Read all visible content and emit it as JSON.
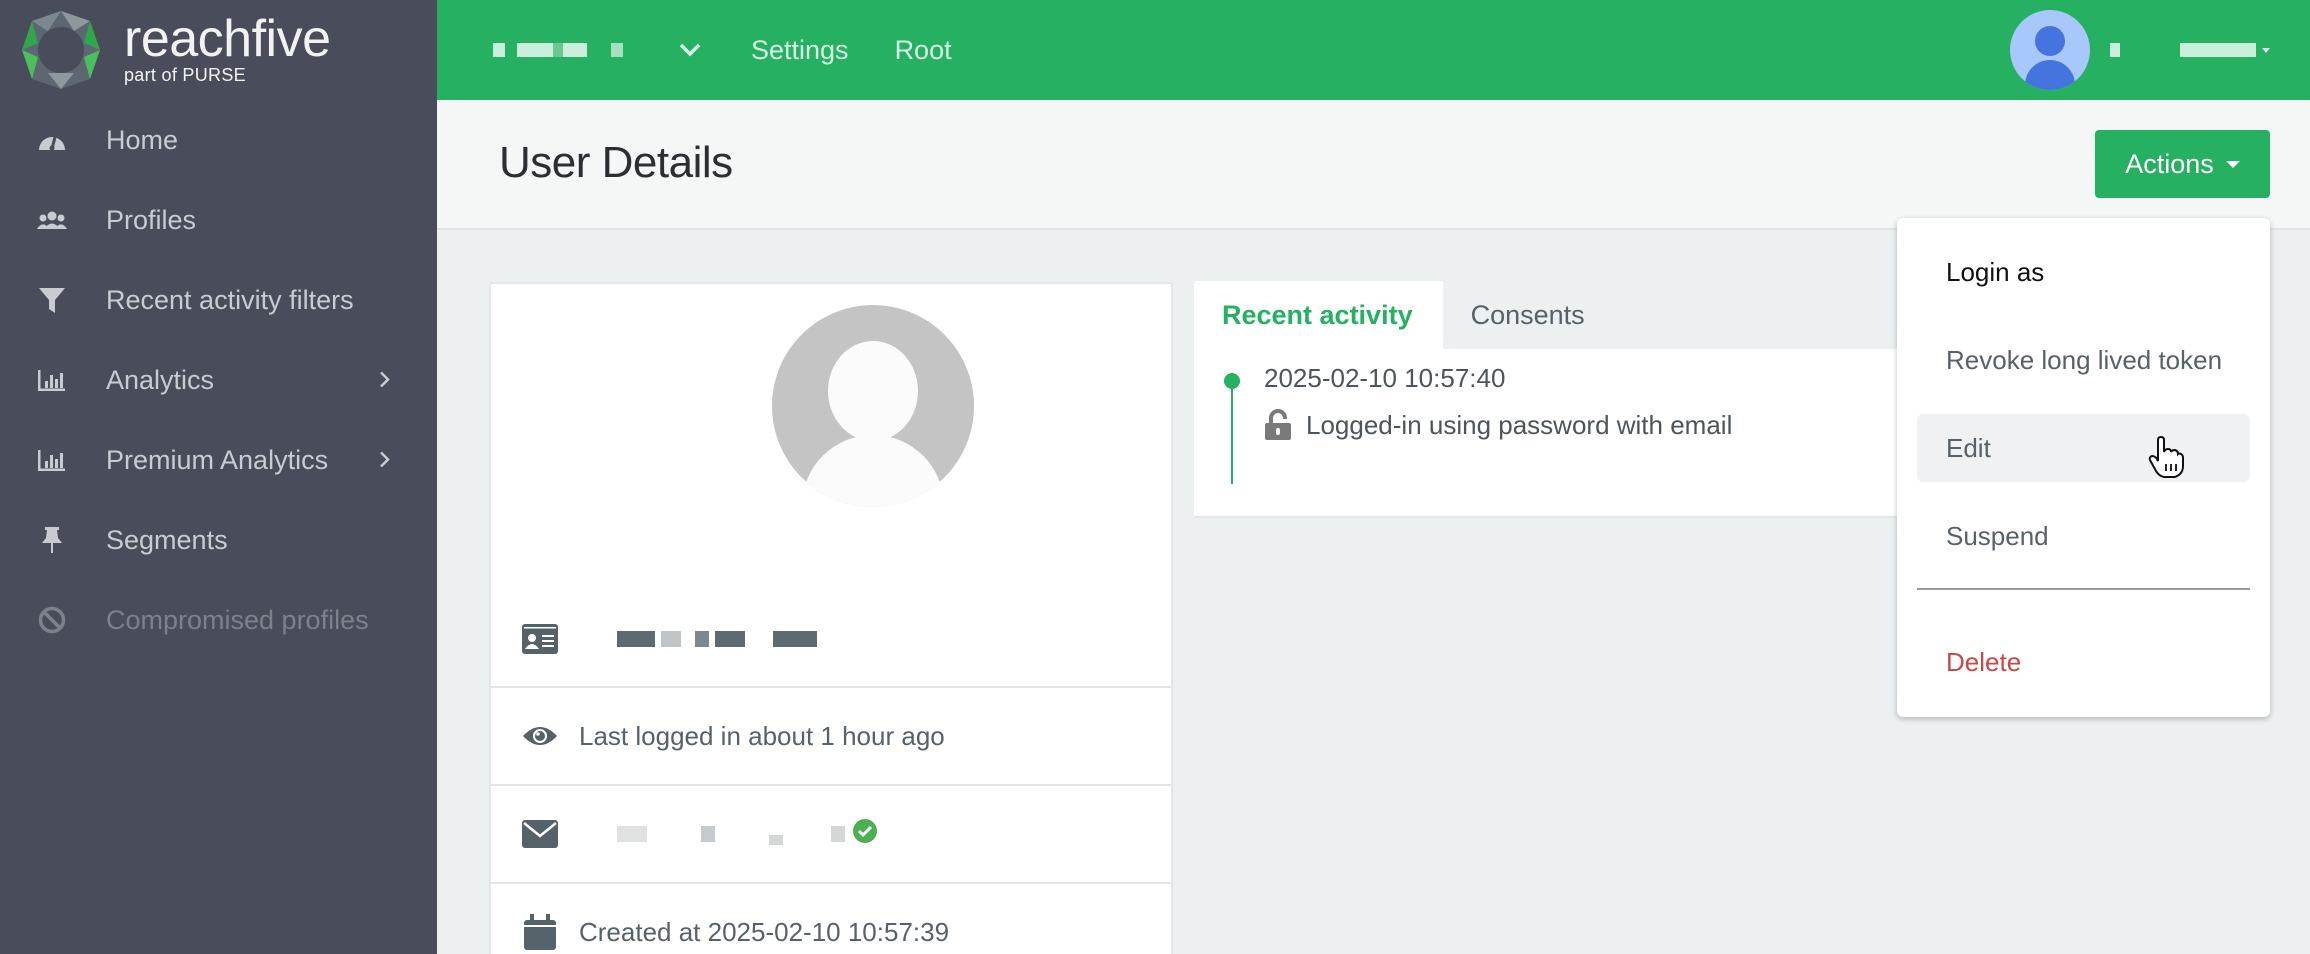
{
  "brand": {
    "name": "reachfive",
    "subtitle": "part of PURSE"
  },
  "sidebar": {
    "items": [
      {
        "label": "Home",
        "icon": "dashboard-gauge-icon",
        "has_submenu": false,
        "disabled": false
      },
      {
        "label": "Profiles",
        "icon": "users-icon",
        "has_submenu": false,
        "disabled": false
      },
      {
        "label": "Recent activity filters",
        "icon": "filter-icon",
        "has_submenu": false,
        "disabled": false
      },
      {
        "label": "Analytics",
        "icon": "bar-chart-icon",
        "has_submenu": true,
        "disabled": false
      },
      {
        "label": "Premium Analytics",
        "icon": "bar-chart-icon",
        "has_submenu": true,
        "disabled": false
      },
      {
        "label": "Segments",
        "icon": "pin-icon",
        "has_submenu": false,
        "disabled": false
      },
      {
        "label": "Compromised profiles",
        "icon": "ban-icon",
        "has_submenu": false,
        "disabled": true
      }
    ]
  },
  "topbar": {
    "tenant_selector": {
      "value": "[redacted]",
      "icon": "chevron-down-icon"
    },
    "links": [
      "Settings",
      "Root"
    ],
    "user": {
      "name": "[redacted]",
      "avatar_icon": "user-avatar-icon"
    }
  },
  "page": {
    "title": "User Details",
    "actions_button": "Actions"
  },
  "actions_menu": {
    "items": [
      {
        "label": "Login as",
        "style": "strong"
      },
      {
        "label": "Revoke long lived token",
        "style": "normal"
      },
      {
        "label": "Edit",
        "style": "hover"
      },
      {
        "label": "Suspend",
        "style": "normal"
      },
      {
        "label": "Delete",
        "style": "danger"
      }
    ]
  },
  "profile": {
    "name": "[redacted]",
    "last_login": "Last logged in about 1 hour ago",
    "email": "[redacted]",
    "email_verified": true,
    "created_at": "Created at 2025-02-10 10:57:39"
  },
  "activity": {
    "tabs": [
      {
        "label": "Recent activity",
        "active": true
      },
      {
        "label": "Consents",
        "active": false
      }
    ],
    "events": [
      {
        "time": "2025-02-10 10:57:40",
        "description": "Logged-in using password with email",
        "icon": "unlock-icon"
      }
    ]
  },
  "colors": {
    "brand_green": "#25b062",
    "sidebar_bg": "#484c5b",
    "danger": "#cd4545",
    "avatar_blue": "#4674df"
  }
}
